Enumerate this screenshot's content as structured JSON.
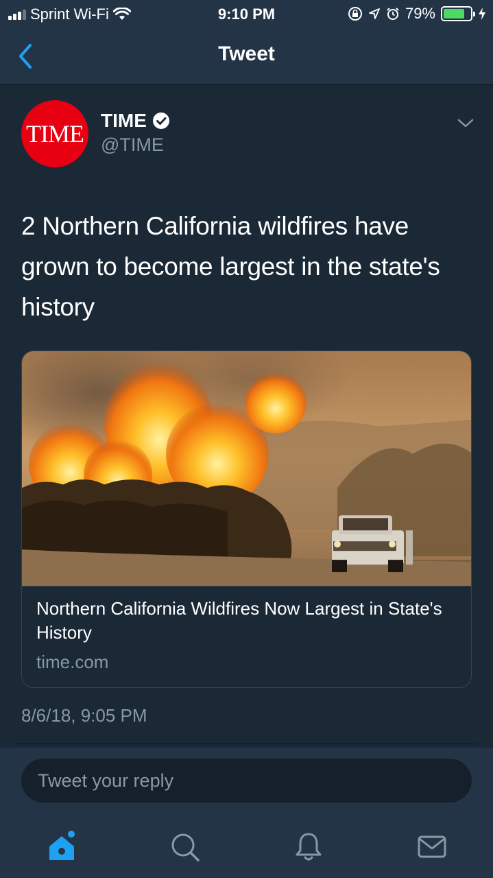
{
  "status_bar": {
    "carrier": "Sprint Wi-Fi",
    "time": "9:10 PM",
    "battery": "79%",
    "battery_level": 0.79
  },
  "nav": {
    "title": "Tweet"
  },
  "tweet": {
    "avatar_text": "TIME",
    "author_name": "TIME",
    "author_handle": "@TIME",
    "text": "2 Northern California wildfires have grown to become largest in the state's history",
    "card": {
      "title": "Northern California Wildfires Now Largest in State's History",
      "domain": "time.com",
      "image": "wildfire-photo"
    },
    "timestamp": "8/6/18, 9:05 PM"
  },
  "reply": {
    "placeholder": "Tweet your reply"
  },
  "tabs": [
    {
      "icon": "home-icon",
      "active": true
    },
    {
      "icon": "search-icon",
      "active": false
    },
    {
      "icon": "bell-icon",
      "active": false
    },
    {
      "icon": "mail-icon",
      "active": false
    }
  ],
  "colors": {
    "background": "#1b2836",
    "bar": "#243447",
    "accent": "#1da1f2",
    "muted": "#8899a6",
    "time_red": "#e60012",
    "battery_green": "#4cd964"
  }
}
